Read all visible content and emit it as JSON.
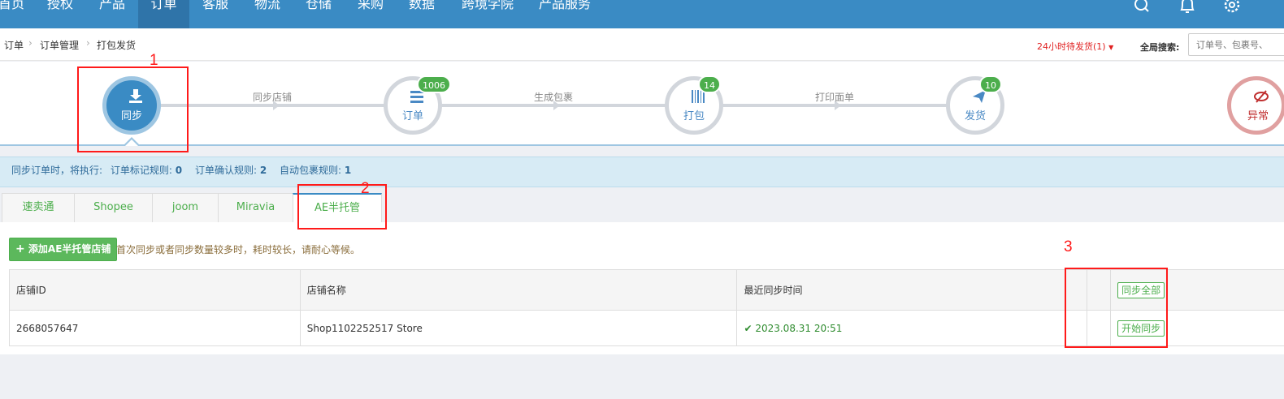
{
  "nav": {
    "items": [
      "首页",
      "授权",
      "产品",
      "订单",
      "客服",
      "物流",
      "仓储",
      "采购",
      "数据",
      "跨境学院",
      "产品服务"
    ],
    "active_index": 3,
    "icons": [
      "search-icon",
      "bell-icon",
      "gear-icon"
    ]
  },
  "breadcrumb": {
    "items": [
      "订单",
      "订单管理",
      "打包发货"
    ]
  },
  "header": {
    "pending": "24小时待发货(1)",
    "search_label": "全局搜索:",
    "search_placeholder": "订单号、包裹号、"
  },
  "steps": {
    "sync": {
      "label": "同步",
      "icon": "download-icon"
    },
    "order": {
      "label": "订单",
      "badge": "1006",
      "icon": "list-icon"
    },
    "pack": {
      "label": "打包",
      "badge": "14",
      "icon": "barcode-icon"
    },
    "ship": {
      "label": "发货",
      "badge": "10",
      "icon": "send-icon"
    },
    "abnormal": {
      "label": "异常",
      "icon": "eye-slash-icon"
    },
    "connectors": [
      "同步店铺",
      "生成包裹",
      "打印面单"
    ]
  },
  "info": {
    "prefix": "同步订单时，将执行:",
    "mark_rule_label": "订单标记规则:",
    "mark_rule_value": "0",
    "confirm_rule_label": "订单确认规则:",
    "confirm_rule_value": "2",
    "pack_rule_label": "自动包裹规则:",
    "pack_rule_value": "1"
  },
  "tabs": [
    "速卖通",
    "Shopee",
    "joom",
    "Miravia",
    "AE半托管"
  ],
  "active_tab": 4,
  "panel": {
    "add_button": "添加AE半托管店铺",
    "hint": "首次同步或者同步数量较多时，耗时较长，请耐心等候。",
    "columns": [
      "店铺ID",
      "店铺名称",
      "最近同步时间"
    ],
    "sync_all": "同步全部",
    "rows": [
      {
        "id": "2668057647",
        "name": "Shop1102252517 Store",
        "time": "2023.08.31 20:51",
        "action": "开始同步"
      }
    ]
  },
  "annotations": [
    "1",
    "2",
    "3"
  ],
  "colors": {
    "nav": "#3a8bc4",
    "accent_green": "#4cae4c",
    "annotation_red": "#ff1a1a"
  }
}
